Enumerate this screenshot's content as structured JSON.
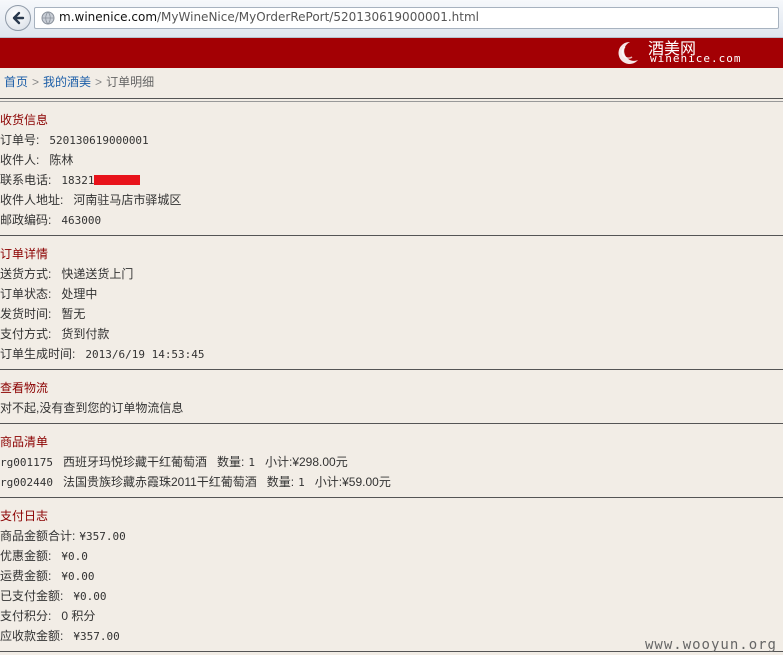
{
  "browser": {
    "url_domain": "m.winenice.com",
    "url_path": "/MyWineNice/MyOrderRePort/520130619000001.html"
  },
  "banner": {
    "logo_cn": "酒美网",
    "logo_en": "winenice.com",
    "brand_color": "#a30004"
  },
  "breadcrumb": {
    "home": "首页",
    "my": "我的酒美",
    "current": "订单明细"
  },
  "shipping": {
    "title": "收货信息",
    "order_no_label": "订单号:",
    "order_no": "520130619000001",
    "receiver_label": "收件人:",
    "receiver": "陈林",
    "phone_label": "联系电话:",
    "phone_prefix": "18321",
    "address_label": "收件人地址:",
    "address": "河南驻马店市驿城区",
    "zip_label": "邮政编码:",
    "zip": "463000"
  },
  "order": {
    "title": "订单详情",
    "delivery_label": "送货方式:",
    "delivery": "快递送货上门",
    "status_label": "订单状态:",
    "status": "处理中",
    "ship_time_label": "发货时间:",
    "ship_time": "暂无",
    "pay_method_label": "支付方式:",
    "pay_method": "货到付款",
    "created_label": "订单生成时间:",
    "created": "2013/6/19 14:53:45"
  },
  "logistics": {
    "title": "查看物流",
    "message": "对不起,没有查到您的订单物流信息"
  },
  "products": {
    "title": "商品清单",
    "items": [
      {
        "code": "rg001175",
        "name": "西班牙玛悦珍藏干红葡萄酒",
        "qty_label": "数量:",
        "qty": "1",
        "subtotal_label": "小计:",
        "subtotal": "¥298.00元"
      },
      {
        "code": "rg002440",
        "name": "法国贵族珍藏赤霞珠2011干红葡萄酒",
        "qty_label": "数量:",
        "qty": "1",
        "subtotal_label": "小计:",
        "subtotal": "¥59.00元"
      }
    ]
  },
  "payment": {
    "title": "支付日志",
    "goods_total_label": "商品金额合计:",
    "goods_total": "¥357.00",
    "discount_label": "优惠金额:",
    "discount": "¥0.0",
    "freight_label": "运费金额:",
    "freight": "¥0.00",
    "paid_label": "已支付金额:",
    "paid": "¥0.00",
    "points_label": "支付积分:",
    "points": "0 积分",
    "receivable_label": "应收款金额:",
    "receivable": "¥357.00"
  },
  "watermark": "www.wooyun.org"
}
